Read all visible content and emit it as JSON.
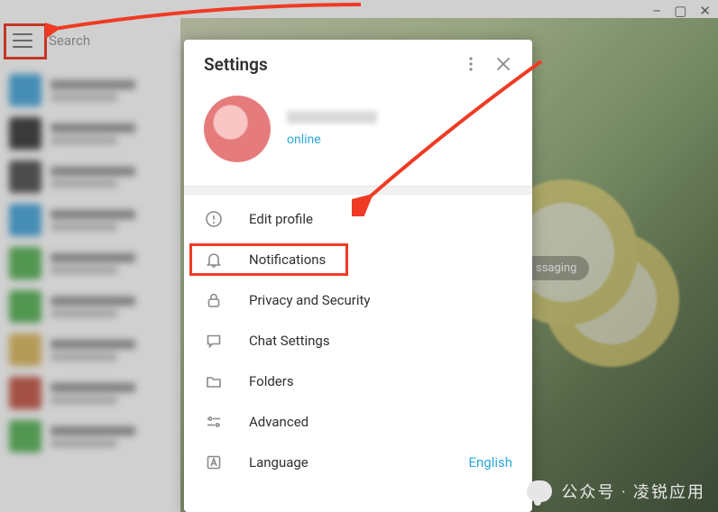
{
  "window": {
    "minimize": "–",
    "maximize": "▢",
    "close": "✕"
  },
  "search": {
    "placeholder": "Search"
  },
  "chat_colors": [
    "#3aa0da",
    "#2b2b2b",
    "#444",
    "#3aa0da",
    "#4cae4c",
    "#4cae4c",
    "#d9b454",
    "#c14b3a",
    "#4cae4c"
  ],
  "right": {
    "badge_partial": "ssaging"
  },
  "settings": {
    "title": "Settings",
    "profile": {
      "status": "online"
    },
    "menu": [
      {
        "id": "edit-profile",
        "label": "Edit profile"
      },
      {
        "id": "notifications",
        "label": "Notifications"
      },
      {
        "id": "privacy",
        "label": "Privacy and Security"
      },
      {
        "id": "chat-settings",
        "label": "Chat Settings"
      },
      {
        "id": "folders",
        "label": "Folders"
      },
      {
        "id": "advanced",
        "label": "Advanced"
      },
      {
        "id": "language",
        "label": "Language",
        "value": "English"
      }
    ]
  },
  "watermark": {
    "text": "公众号 · 凌锐应用"
  }
}
